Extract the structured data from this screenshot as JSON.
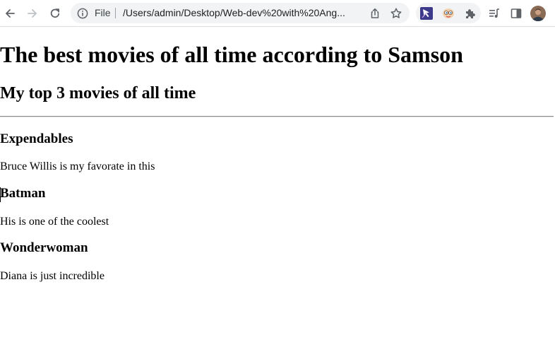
{
  "browser": {
    "scheme_label": "File",
    "url": "/Users/admin/Desktop/Web-dev%20with%20Ang...",
    "icons": {
      "back": "arrow-left-icon",
      "forward": "arrow-right-icon",
      "reload": "reload-icon",
      "info": "info-icon",
      "share": "share-icon",
      "bookmark": "star-icon",
      "extension_1": "cursor-extension-icon",
      "extension_2": "eyes-extension-icon",
      "extensions": "puzzle-icon",
      "media": "media-queue-icon",
      "side_panel": "side-panel-icon",
      "profile": "avatar"
    }
  },
  "page": {
    "heading": "The best movies of all time according to Samson",
    "subheading": "My top 3 movies of all time",
    "movies": [
      {
        "title": "Expendables",
        "description": "Bruce Willis is my favorate in this"
      },
      {
        "title": "Batman",
        "description": "His is one of the coolest"
      },
      {
        "title": "Wonderwoman",
        "description": "Diana is just incredible"
      }
    ]
  }
}
